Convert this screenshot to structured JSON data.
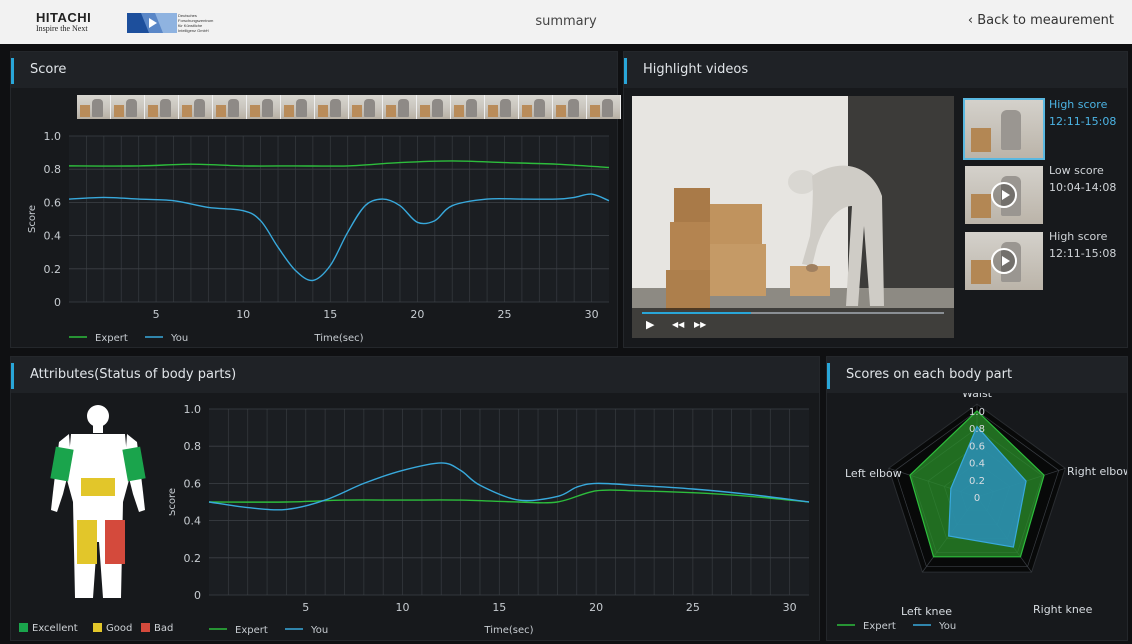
{
  "header": {
    "hitachi_name": "HITACHI",
    "hitachi_tagline": "Inspire the Next",
    "dfki_text": [
      "Deutsches",
      "Forschungszentrum",
      "für Künstliche",
      "Intelligenz GmbH"
    ],
    "page_title": "summary",
    "back_label": "‹ Back to meaurement"
  },
  "panels": {
    "score": "Score",
    "highlights": "Highlight videos",
    "attributes": "Attributes(Status of body parts)",
    "bodypart_scores": "Scores on each body part"
  },
  "colors": {
    "expert": "#2dbd3c",
    "you": "#38a9dc",
    "excellent": "#1aa44c",
    "good": "#e2c62a",
    "bad": "#d44a3c",
    "accent": "#29a6d8"
  },
  "highlights": {
    "items": [
      {
        "label": "High score",
        "time": "12:11-15:08",
        "active": true
      },
      {
        "label": "Low score",
        "time": "10:04-14:08",
        "active": false
      },
      {
        "label": "High score",
        "time": "12:11-15:08",
        "active": false
      }
    ],
    "progress": 0.36,
    "controls": {
      "play": "▶",
      "rewind": "◀◀",
      "forward": "▶▶"
    }
  },
  "body_legend": {
    "excellent": "Excellent",
    "good": "Good",
    "bad": "Bad"
  },
  "body_status": {
    "left_arm": "excellent",
    "right_arm": "excellent",
    "waist": "good",
    "left_leg": "good",
    "right_leg": "bad"
  },
  "chart_data": [
    {
      "type": "line",
      "title": "",
      "xlabel": "Time(sec)",
      "ylabel": "Score",
      "xlim": [
        0,
        31
      ],
      "ylim": [
        0,
        1.0
      ],
      "xticks": [
        5,
        10,
        15,
        20,
        25,
        30
      ],
      "yticks": [
        0,
        0.2,
        0.4,
        0.6,
        0.8,
        1.0
      ],
      "grid": true,
      "legend": "bottom-left",
      "series": [
        {
          "name": "Expert",
          "x": [
            0,
            4,
            7,
            10,
            13,
            16,
            19,
            22,
            25,
            28,
            31
          ],
          "y": [
            0.82,
            0.82,
            0.83,
            0.82,
            0.82,
            0.82,
            0.84,
            0.85,
            0.84,
            0.83,
            0.81
          ]
        },
        {
          "name": "You",
          "x": [
            0,
            2,
            4,
            6,
            8,
            10,
            11,
            12,
            13,
            14,
            15,
            16,
            17,
            18,
            19,
            20,
            21,
            22,
            24,
            26,
            28,
            29,
            30,
            31
          ],
          "y": [
            0.62,
            0.63,
            0.62,
            0.61,
            0.57,
            0.55,
            0.49,
            0.33,
            0.19,
            0.13,
            0.22,
            0.42,
            0.58,
            0.62,
            0.58,
            0.48,
            0.49,
            0.58,
            0.62,
            0.62,
            0.62,
            0.63,
            0.65,
            0.61
          ]
        }
      ]
    },
    {
      "type": "line",
      "title": "",
      "xlabel": "Time(sec)",
      "ylabel": "Score",
      "xlim": [
        0,
        31
      ],
      "ylim": [
        0,
        1.0
      ],
      "xticks": [
        5,
        10,
        15,
        20,
        25,
        30
      ],
      "yticks": [
        0,
        0.2,
        0.4,
        0.6,
        0.8,
        1.0
      ],
      "grid": true,
      "legend": "bottom-left",
      "series": [
        {
          "name": "Expert",
          "x": [
            0,
            4,
            7,
            10,
            13,
            16,
            18,
            20,
            22,
            25,
            28,
            31
          ],
          "y": [
            0.5,
            0.5,
            0.51,
            0.51,
            0.51,
            0.5,
            0.5,
            0.56,
            0.56,
            0.55,
            0.53,
            0.5
          ]
        },
        {
          "name": "You",
          "x": [
            0,
            2,
            4,
            6,
            8,
            10,
            12,
            13,
            14,
            16,
            18,
            19,
            20,
            22,
            25,
            28,
            31
          ],
          "y": [
            0.5,
            0.47,
            0.46,
            0.51,
            0.6,
            0.67,
            0.71,
            0.67,
            0.59,
            0.51,
            0.53,
            0.58,
            0.6,
            0.59,
            0.57,
            0.54,
            0.5
          ]
        }
      ]
    },
    {
      "type": "radar",
      "title": "",
      "axes": [
        "Waist",
        "Right elbow",
        "Right knee",
        "Left knee",
        "Left elbow"
      ],
      "rlim": [
        0,
        1.0
      ],
      "rticks": [
        0,
        0.2,
        0.4,
        0.6,
        0.8,
        1.0
      ],
      "legend": "bottom-left",
      "series": [
        {
          "name": "Expert",
          "values": [
            1.0,
            0.82,
            0.86,
            0.86,
            0.82
          ]
        },
        {
          "name": "You",
          "values": [
            0.82,
            0.6,
            0.72,
            0.56,
            0.32
          ]
        }
      ]
    }
  ]
}
